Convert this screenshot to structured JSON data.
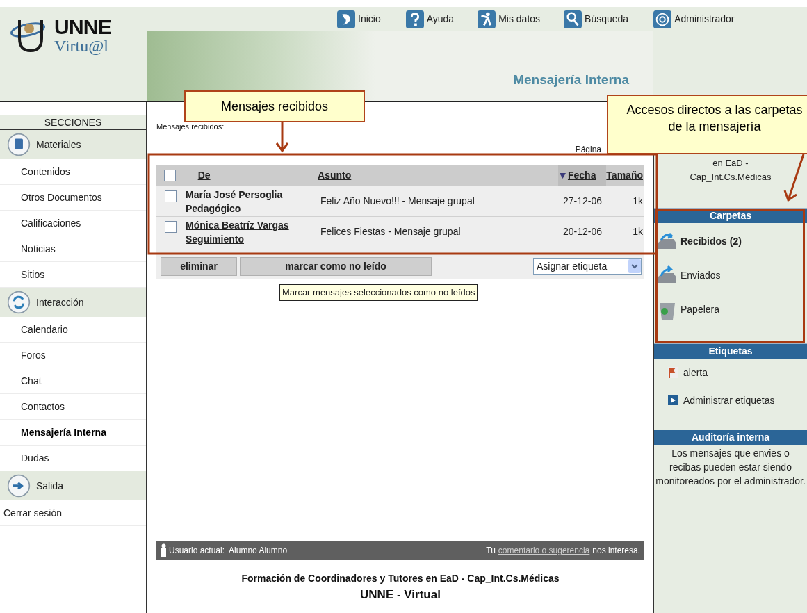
{
  "logo": {
    "line1": "UNNE",
    "line2": "Virtu@l"
  },
  "top_nav": [
    {
      "label": "Inicio"
    },
    {
      "label": "Ayuda"
    },
    {
      "label": "Mis datos"
    },
    {
      "label": "Búsqueda"
    },
    {
      "label": "Administrador"
    }
  ],
  "banner": {
    "title": "Mensajería Interna"
  },
  "sidebar": {
    "heading": "SECCIONES",
    "items": [
      {
        "kind": "section",
        "label": "Materiales",
        "selected": false
      },
      {
        "kind": "item",
        "label": "Contenidos",
        "selected": false
      },
      {
        "kind": "item",
        "label": "Otros Documentos",
        "selected": false
      },
      {
        "kind": "item",
        "label": "Calificaciones",
        "selected": false
      },
      {
        "kind": "item",
        "label": "Noticias",
        "selected": false
      },
      {
        "kind": "item",
        "label": "Sitios",
        "selected": false
      },
      {
        "kind": "section",
        "label": "Interacción",
        "selected": false
      },
      {
        "kind": "item",
        "label": "Calendario",
        "selected": false
      },
      {
        "kind": "item",
        "label": "Foros",
        "selected": false
      },
      {
        "kind": "item",
        "label": "Chat",
        "selected": false
      },
      {
        "kind": "item",
        "label": "Contactos",
        "selected": false
      },
      {
        "kind": "item",
        "label": "Mensajería Interna",
        "selected": true
      },
      {
        "kind": "item",
        "label": "Dudas",
        "selected": false
      },
      {
        "kind": "section",
        "label": "Salida",
        "selected": false
      },
      {
        "kind": "logout",
        "label": "Cerrar sesión",
        "selected": false
      }
    ]
  },
  "messages": {
    "heading": "Mensajes recibidos:",
    "pager": "Página",
    "select_all": {
      "checked": false
    },
    "columns": [
      {
        "label": "De",
        "sorted": false
      },
      {
        "label": "Asunto",
        "sorted": false
      },
      {
        "label": "Fecha",
        "sorted": true
      },
      {
        "label": "Tamaño",
        "sorted": false
      }
    ],
    "rows": [
      {
        "checked": false,
        "sender": "María José Persoglia",
        "sender_group": "Pedagógico",
        "subject": "Feliz Año Nuevo!!! - Mensaje grupal",
        "date": "27-12-06",
        "size": "1k"
      },
      {
        "checked": false,
        "sender": "Mónica Beatríz Vargas",
        "sender_group": "Seguimiento",
        "subject": "Felices Fiestas - Mensaje grupal",
        "date": "20-12-06",
        "size": "1k"
      }
    ],
    "actions": [
      "eliminar",
      "marcar como no leído"
    ],
    "label_select": {
      "value": "Asignar etiqueta"
    },
    "tooltip": "Marcar mensajes seleccionados como no leídos"
  },
  "footer": {
    "user_label": "Usuario actual:",
    "user_name": "Alumno Alumno",
    "feedback_prefix": "Tu",
    "feedback_link": "comentario o sugerencia",
    "feedback_suffix": "nos interesa.",
    "course": "Formación de Coordinadores y Tutores en EaD - Cap_Int.Cs.Médicas",
    "site": "UNNE - Virtual"
  },
  "right_panel": {
    "course_lines": [
      "en EaD -",
      "Cap_Int.Cs.Médicas"
    ],
    "folders": {
      "title": "Carpetas",
      "items": [
        {
          "label": "Recibidos (2)",
          "unread": true
        },
        {
          "label": "Enviados",
          "unread": false
        },
        {
          "label": "Papelera",
          "unread": false
        }
      ]
    },
    "labels": {
      "title": "Etiquetas",
      "items": [
        {
          "kind": "tag",
          "label": "alerta"
        },
        {
          "kind": "manage",
          "label": "Administrar etiquetas"
        }
      ]
    },
    "audit": {
      "title": "Auditoría interna",
      "text": "Los mensajes que envies o recibas pueden estar siendo monitoreados por el administrador."
    }
  },
  "callouts": [
    {
      "text": "Mensajes recibidos"
    },
    {
      "text": "Accesos directos a las carpetas de la mensajería"
    }
  ]
}
